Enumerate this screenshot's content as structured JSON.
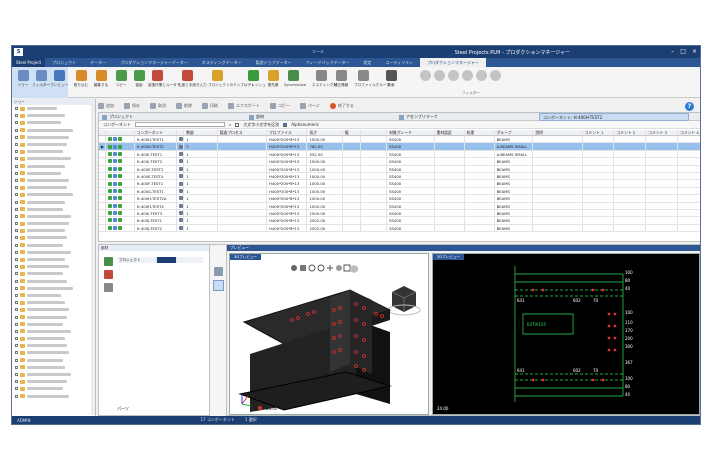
{
  "titlebar": {
    "app_context": "ツール",
    "title": "Steel Projects PLM - プロダクションマネージャー",
    "window_controls": [
      "–",
      "□",
      "×"
    ]
  },
  "menubar": {
    "file": "Steel Project",
    "tabs": [
      "プロジェクト",
      "データー",
      "プロダクションマネージャーデーター",
      "ネスティングデーター",
      "製造ジョブデーター",
      "フィードバックデーター",
      "設定",
      "ユーティリティ",
      "プロダクションマネージャー"
    ],
    "active_tab": "プロダクションマネージャー"
  },
  "ribbon": {
    "buttons": [
      {
        "label": "ツリー",
        "color": "#6a8cc4"
      },
      {
        "label": "フィルター",
        "color": "#6a8cc4"
      },
      {
        "label": "プレビュー",
        "color": "#4a78c0"
      },
      {
        "label": "取り込む",
        "color": "#d98b2b"
      },
      {
        "label": "編集する",
        "color": "#d98b2b"
      },
      {
        "label": "コピー",
        "color": "#4a9c4a"
      },
      {
        "label": "複製",
        "color": "#4a9c4a"
      },
      {
        "label": "製造作業とルーター",
        "color": "#c24a3a"
      },
      {
        "label": "生産と手続き入力",
        "color": "#c24a3a"
      },
      {
        "label": "プロジェクトのテンプレート",
        "color": "#d9a22b"
      },
      {
        "label": "リフレッシュ",
        "color": "#3a9c3a"
      },
      {
        "label": "優先順",
        "color": "#d9a22b"
      },
      {
        "label": "Synchronize",
        "color": "#4a8c4a"
      },
      {
        "label": "ネスティング対",
        "color": "#888888"
      },
      {
        "label": "補正情報",
        "color": "#888888"
      },
      {
        "label": "プロファイルグループ",
        "color": "#888888"
      },
      {
        "label": "検索",
        "color": "#555555"
      }
    ],
    "group_label": "フィルター"
  },
  "toolbar2": {
    "items": [
      "追加",
      "保存",
      "取消",
      "削除",
      "印刷",
      "エクスポート",
      "コピー",
      "ページ",
      "終了する"
    ]
  },
  "help_label": "?",
  "left_panel": {
    "header": "ツリー",
    "row_widths": [
      30,
      38,
      34,
      46,
      42,
      40,
      36,
      44,
      38,
      34,
      42,
      40,
      46,
      38,
      36,
      44,
      42,
      38,
      40,
      36,
      44,
      38,
      42,
      36,
      40,
      46,
      34,
      38,
      42,
      40,
      36,
      44,
      38,
      40,
      42,
      36,
      38,
      44,
      40,
      36,
      42
    ]
  },
  "infobar": {
    "project_label": "プロジェクト",
    "project_value": "",
    "table_label": "部材",
    "assembly_label": "アセンブリマーク",
    "component_label": "コンポーネント",
    "component_value": "H-400H-TEST2"
  },
  "filterbar": {
    "label": "コンポーネント",
    "case_label": "大文字小文字を区別",
    "alnum_label": "Alphanumeric"
  },
  "grid": {
    "columns": [
      "",
      "",
      "コンポーネント",
      "",
      "数量",
      "製造プロセス",
      "プロファイル",
      "長さ",
      "幅",
      "",
      "材質グレード",
      "素材認証",
      "処理",
      "グループ",
      "説明",
      "コメント 1",
      "コメント 2",
      "コメント 3",
      "コメント 4"
    ],
    "rows": [
      {
        "name": "H-400H-TEST1",
        "qty": "1",
        "profile": "H400*200*8*13",
        "length": "1000.00",
        "grade": "SS400",
        "group": "BEAMS"
      },
      {
        "name": "H-400H-TEST2",
        "qty": "2",
        "profile": "H400*200*8*13",
        "length": "762.00",
        "grade": "SS400",
        "group": "A-BEAMS SMALL",
        "selected": true
      },
      {
        "name": "H-400I-TEST1",
        "qty": "1",
        "profile": "H400*200*8*13",
        "length": "552.00",
        "grade": "SS400",
        "group": "A-BEAMS SMALL"
      },
      {
        "name": "H-400I-TEST2",
        "qty": "1",
        "profile": "H400*200*8*13",
        "length": "1000.00",
        "grade": "SS400",
        "group": "BEAMS"
      },
      {
        "name": "H-400E-TEST2",
        "qty": "1",
        "profile": "H400*200*8*13",
        "length": "1000.00",
        "grade": "SS400",
        "group": "BEAMS"
      },
      {
        "name": "H-400E-TEST4",
        "qty": "1",
        "profile": "H400*200*8*13",
        "length": "1000.00",
        "grade": "SS400",
        "group": "BEAMS"
      },
      {
        "name": "H-400F-TEST1",
        "qty": "1",
        "profile": "H400*200*8*13",
        "length": "1000.00",
        "grade": "SS400",
        "group": "BEAMS"
      },
      {
        "name": "H-400G-TEST1",
        "qty": "1",
        "profile": "H400*200*8*13",
        "length": "1000.00",
        "grade": "SS400",
        "group": "BEAMS"
      },
      {
        "name": "H-400H-TEST2A",
        "qty": "1",
        "profile": "H400*200*8*13",
        "length": "1000.00",
        "grade": "SS400",
        "group": "BEAMS"
      },
      {
        "name": "H-400H-TEST4",
        "qty": "1",
        "profile": "H400*200*8*13",
        "length": "1000.00",
        "grade": "SS400",
        "group": "BEAMS"
      },
      {
        "name": "H-400I-TEST3",
        "qty": "1",
        "profile": "H400*200*8*13",
        "length": "1000.00",
        "grade": "SS400",
        "group": "BEAMS"
      },
      {
        "name": "H-400J-TEST1",
        "qty": "1",
        "profile": "H400*200*8*13",
        "length": "2502.00",
        "grade": "SS400",
        "group": "BEAMS"
      },
      {
        "name": "H-400J-TEST2",
        "qty": "1",
        "profile": "H400*200*8*13",
        "length": "2502.00",
        "grade": "SS400",
        "group": "BEAMS"
      }
    ]
  },
  "bottom_left": {
    "header": "部材",
    "table_head": [
      "プロジェクト",
      ""
    ],
    "footer": "パーツ"
  },
  "preview": {
    "header": "プレビュー",
    "tab3d": "3Dプレビュー",
    "tab2d": "2Dプレビュー",
    "scale_label": "24.00",
    "dim_labels_right": [
      "100",
      "80",
      "40",
      "100",
      "110",
      "170",
      "200",
      "300",
      "367",
      "100",
      "80",
      "40"
    ],
    "dim_labels_bottom": [
      "641",
      "602",
      "70"
    ],
    "part_label": "E0TIA155",
    "scale_2d": "24.00"
  },
  "statusbar": {
    "user": "ADMIN",
    "company": "",
    "components": "17 コンポーネント",
    "selected": "1 選択",
    "date": ""
  }
}
